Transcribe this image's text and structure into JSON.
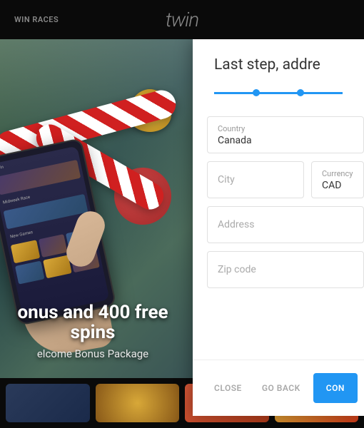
{
  "header": {
    "nav_item": "WIN RACES",
    "logo": "twin"
  },
  "promo": {
    "title_line1": "onus and 400 free",
    "title_line2": "spins",
    "subtitle": "elcome Bonus Package"
  },
  "modal": {
    "title": "Last step, addre",
    "fields": {
      "country": {
        "label": "Country",
        "value": "Canada"
      },
      "city": {
        "placeholder": "City"
      },
      "currency": {
        "label": "Currency",
        "value": "CAD"
      },
      "address": {
        "placeholder": "Address"
      },
      "zip": {
        "placeholder": "Zip code"
      }
    },
    "actions": {
      "close": "CLOSE",
      "back": "GO BACK",
      "continue": "CON"
    }
  }
}
